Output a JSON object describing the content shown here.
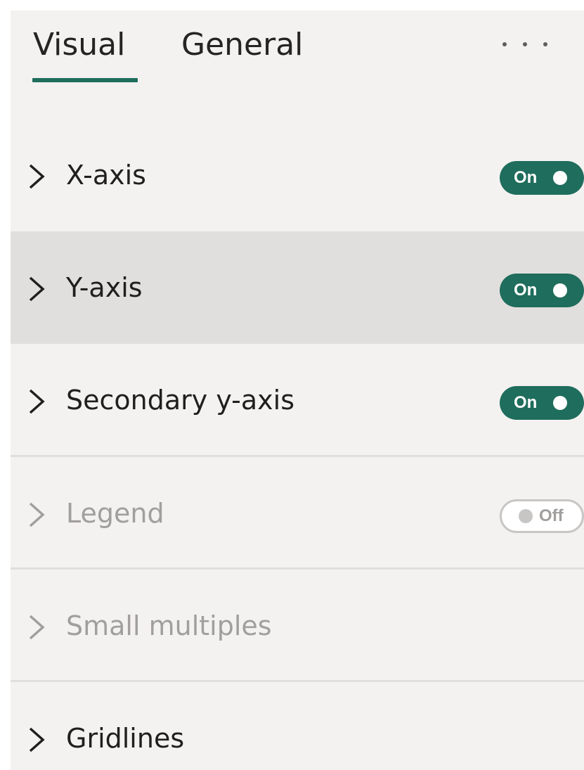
{
  "tabs": {
    "visual": "Visual",
    "general": "General",
    "active": "Visual"
  },
  "sections": [
    {
      "label": "X-axis",
      "toggle": "On"
    },
    {
      "label": "Y-axis",
      "toggle": "On"
    },
    {
      "label": "Secondary y-axis",
      "toggle": "On"
    },
    {
      "label": "Legend",
      "toggle": "Off"
    },
    {
      "label": "Small multiples"
    },
    {
      "label": "Gridlines"
    }
  ],
  "colors": {
    "accent": "#1f6d5c",
    "pane_background": "#f3f2f1",
    "hover_row": "#e1dfdd",
    "disabled_text": "#a19f9d"
  },
  "icons": {
    "more": "more-options-icon",
    "expand": "chevron-right-icon"
  }
}
